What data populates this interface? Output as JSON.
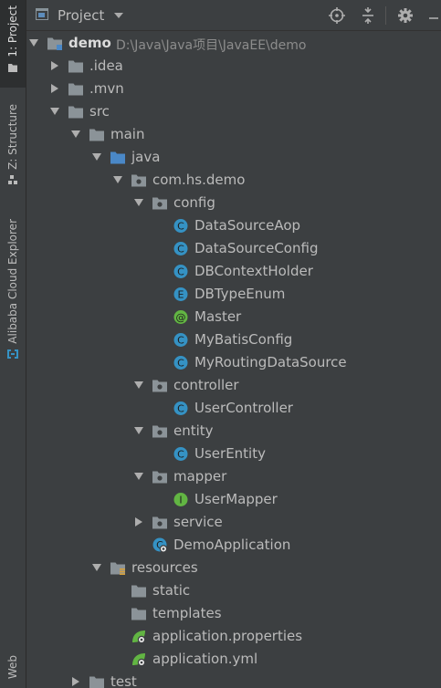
{
  "window": {
    "title": "Project"
  },
  "side_tabs": [
    "1: Project",
    "Z: Structure",
    "Alibaba Cloud Explorer",
    "Web"
  ],
  "colors": {
    "accent": "#4a88c7",
    "folder": "#8b9398",
    "class": "#3592c4",
    "annotation": "#62b543",
    "interface": "#62b543"
  },
  "tree": [
    {
      "label": "demo",
      "path": "D:\\Java\\Java项目\\JavaEE\\demo",
      "depth": 0,
      "arrow": "down",
      "icon": "module-folder-icon",
      "bold": true
    },
    {
      "label": ".idea",
      "depth": 1,
      "arrow": "right",
      "icon": "folder-icon"
    },
    {
      "label": ".mvn",
      "depth": 1,
      "arrow": "right",
      "icon": "folder-icon"
    },
    {
      "label": "src",
      "depth": 1,
      "arrow": "down",
      "icon": "folder-icon"
    },
    {
      "label": "main",
      "depth": 2,
      "arrow": "down",
      "icon": "folder-icon"
    },
    {
      "label": "java",
      "depth": 3,
      "arrow": "down",
      "icon": "source-folder-icon"
    },
    {
      "label": "com.hs.demo",
      "depth": 4,
      "arrow": "down",
      "icon": "package-icon"
    },
    {
      "label": "config",
      "depth": 5,
      "arrow": "down",
      "icon": "package-icon"
    },
    {
      "label": "DataSourceAop",
      "depth": 6,
      "icon": "class-icon",
      "letter": "C"
    },
    {
      "label": "DataSourceConfig",
      "depth": 6,
      "icon": "class-icon",
      "letter": "C"
    },
    {
      "label": "DBContextHolder",
      "depth": 6,
      "icon": "class-icon",
      "letter": "C"
    },
    {
      "label": "DBTypeEnum",
      "depth": 6,
      "icon": "enum-icon",
      "letter": "E"
    },
    {
      "label": "Master",
      "depth": 6,
      "icon": "annotation-icon",
      "letter": "@"
    },
    {
      "label": "MyBatisConfig",
      "depth": 6,
      "icon": "class-icon",
      "letter": "C"
    },
    {
      "label": "MyRoutingDataSource",
      "depth": 6,
      "icon": "class-icon",
      "letter": "C"
    },
    {
      "label": "controller",
      "depth": 5,
      "arrow": "down",
      "icon": "package-icon"
    },
    {
      "label": "UserController",
      "depth": 6,
      "icon": "class-icon",
      "letter": "C"
    },
    {
      "label": "entity",
      "depth": 5,
      "arrow": "down",
      "icon": "package-icon"
    },
    {
      "label": "UserEntity",
      "depth": 6,
      "icon": "class-icon",
      "letter": "C"
    },
    {
      "label": "mapper",
      "depth": 5,
      "arrow": "down",
      "icon": "package-icon"
    },
    {
      "label": "UserMapper",
      "depth": 6,
      "icon": "interface-icon",
      "letter": "I"
    },
    {
      "label": "service",
      "depth": 5,
      "arrow": "right",
      "icon": "package-icon"
    },
    {
      "label": "DemoApplication",
      "depth": 5,
      "icon": "spring-boot-class-icon",
      "letter": "C"
    },
    {
      "label": "resources",
      "depth": 3,
      "arrow": "down",
      "icon": "resources-folder-icon"
    },
    {
      "label": "static",
      "depth": 4,
      "icon": "folder-icon"
    },
    {
      "label": "templates",
      "depth": 4,
      "icon": "folder-icon"
    },
    {
      "label": "application.properties",
      "depth": 4,
      "icon": "spring-config-icon"
    },
    {
      "label": "application.yml",
      "depth": 4,
      "icon": "spring-config-icon"
    },
    {
      "label": "test",
      "depth": 2,
      "arrow": "right",
      "icon": "folder-icon"
    }
  ]
}
